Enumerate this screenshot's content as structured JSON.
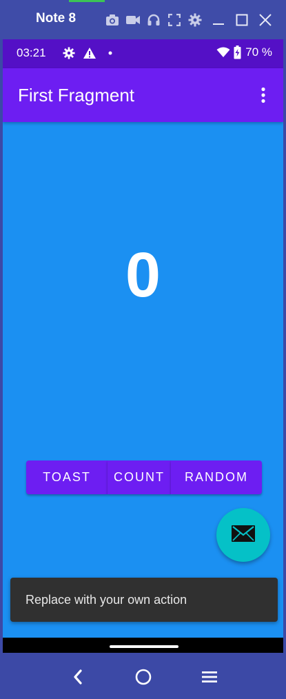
{
  "emulator": {
    "title": "Note 8",
    "icons": [
      "camera-icon",
      "video-icon",
      "headphones-icon",
      "fullscreen-icon",
      "gear-icon",
      "minimize-icon",
      "maximize-icon",
      "close-icon"
    ]
  },
  "status_bar": {
    "time": "03:21",
    "battery": "70 %",
    "icons": [
      "gear-icon",
      "warning-icon",
      "dot-icon",
      "wifi-icon",
      "battery-charging-icon"
    ]
  },
  "app_bar": {
    "title": "First Fragment",
    "overflow_icon": "more-vert-icon"
  },
  "main": {
    "count": "0",
    "buttons": {
      "toast": "TOAST",
      "count": "COUNT",
      "random": "RANDOM"
    }
  },
  "fab": {
    "icon": "mail-icon"
  },
  "snackbar": {
    "text": "Replace with your own action"
  },
  "nav": {
    "icons": [
      "back-icon",
      "home-icon",
      "menu-icon"
    ]
  },
  "colors": {
    "status_bar": "#5410c6",
    "app_bar": "#6d1ef2",
    "background": "#1b90f2",
    "fab": "#05c1c7",
    "snackbar": "#303030",
    "emulator_chrome": "#3c49a6"
  }
}
